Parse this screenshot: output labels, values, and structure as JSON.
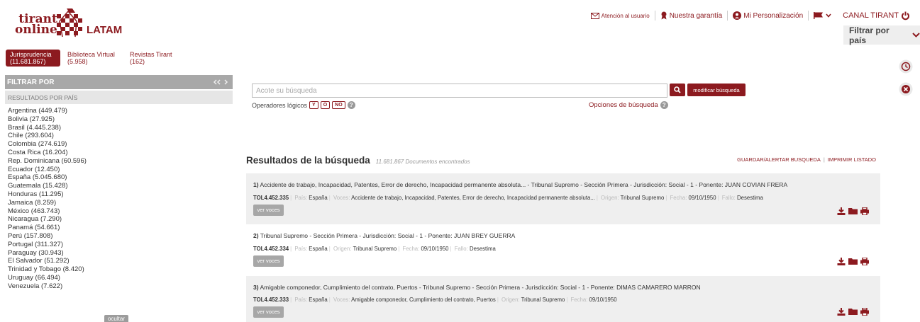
{
  "brand": {
    "line1": "tirant",
    "line2": "online",
    "region": "LATAM"
  },
  "topbar": {
    "attention": "Atención al usuario",
    "guarantee": "Nuestra garantía",
    "personalization": "Mi Personalización",
    "channel": "CANAL TIRANT",
    "filter_country": "Filtrar por país"
  },
  "tabs": [
    {
      "label": "Jurisprudencia",
      "count": "(11.681.867)"
    },
    {
      "label": "Biblioteca Virtual",
      "count": "(5.958)"
    },
    {
      "label": "Revistas Tirant",
      "count": "(162)"
    }
  ],
  "sidebar": {
    "title": "FILTRAR POR",
    "section": "RESULTADOS POR PAÍS",
    "hide": "ocultar",
    "countries": [
      "Argentina (449.479)",
      "Bolivia (27.925)",
      "Brasil (4.445.238)",
      "Chile (293.604)",
      "Colombia (274.619)",
      "Costa Rica (16.204)",
      "Rep. Dominicana (60.596)",
      "Ecuador (12.450)",
      "España (5.045.680)",
      "Guatemala (15.428)",
      "Honduras (11.295)",
      "Jamaica (8.259)",
      "México (463.743)",
      "Nicaragua (7.290)",
      "Panamá (54.661)",
      "Perú (157.808)",
      "Portugal (311.327)",
      "Paraguay (30.943)",
      "El Salvador (51.292)",
      "Trinidad y Tobago (8.420)",
      "Uruguay (66.494)",
      "Venezuela (7.622)"
    ]
  },
  "search": {
    "placeholder": "Acote su búsqueda",
    "modify": "modificar búsqueda",
    "operators_label": "Operadores lógicos",
    "ops": [
      "Y",
      "O",
      "NO"
    ],
    "options": "Opciones de búsqueda"
  },
  "results": {
    "title": "Resultados de la búsqueda",
    "count": "11.681.867 Documentos encontrados",
    "save": "GUARDAR/ALERTAR BUSQUEDA",
    "print": "IMPRIMIR LISTADO",
    "view_voices": "ver voces",
    "items": [
      {
        "num": "1)",
        "title": "Accidente de trabajo, Incapacidad, Patentes, Error de derecho, Incapacidad permanente absoluta... - Tribunal Supremo - Sección Primera - Jurisdicción: Social - 1 - Ponente: JUAN COVIAN FRERA",
        "id": "TOL4.452.335",
        "pais_k": "País:",
        "pais": "España",
        "voces_k": "Voces:",
        "voces": "Accidente de trabajo, Incapacidad, Patentes, Error de derecho, Incapacidad permanente absoluta...",
        "origen_k": "Origen:",
        "origen": "Tribunal Supremo",
        "fecha_k": "Fecha:",
        "fecha": "09/10/1950",
        "fallo_k": "Fallo:",
        "fallo": "Desestima"
      },
      {
        "num": "2)",
        "title": "Tribunal Supremo - Sección Primera - Jurisdicción: Social - 1 - Ponente: JUAN BREY GUERRA",
        "id": "TOL4.452.334",
        "pais_k": "País:",
        "pais": "España",
        "origen_k": "Origen:",
        "origen": "Tribunal Supremo",
        "fecha_k": "Fecha:",
        "fecha": "09/10/1950",
        "fallo_k": "Fallo:",
        "fallo": "Desestima"
      },
      {
        "num": "3)",
        "title": "Amigable componedor, Cumplimiento del contrato, Puertos - Tribunal Supremo - Sección Primera - Jurisdicción: Social - 1 - Ponente: DIMAS CAMARERO MARRON",
        "id": "TOL4.452.333",
        "pais_k": "País:",
        "pais": "España",
        "voces_k": "Voces:",
        "voces": "Amigable componedor, Cumplimiento del contrato, Puertos",
        "origen_k": "Origen:",
        "origen": "Tribunal Supremo",
        "fecha_k": "Fecha:",
        "fecha": "09/10/1950"
      }
    ]
  },
  "colors": {
    "brand": "#8c1a1f",
    "sidebar_head": "#a8a8a8",
    "row_alt": "#efefef"
  },
  "icons": [
    "envelope-icon",
    "ribbon-icon",
    "user-circle-icon",
    "flag-icon",
    "power-icon",
    "history-icon",
    "close-circle-icon",
    "download-icon",
    "folder-icon",
    "print-icon",
    "search-icon"
  ]
}
